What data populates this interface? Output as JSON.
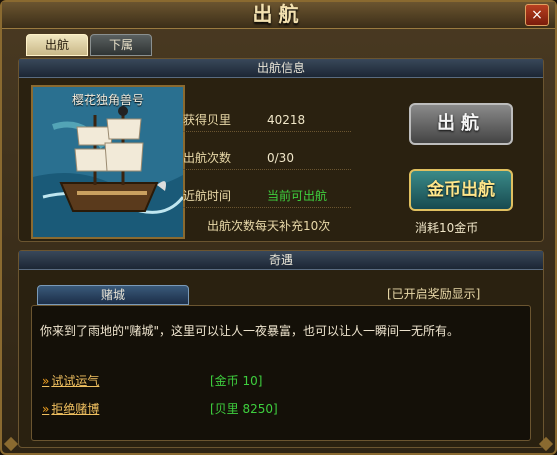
{
  "window": {
    "title": "出航",
    "close_label": "×"
  },
  "tabs": [
    {
      "label": "出航"
    },
    {
      "label": "下属"
    }
  ],
  "sail_info": {
    "header": "出航信息",
    "ship_name": "樱花独角兽号",
    "rows": [
      {
        "key": "获得贝里",
        "value": "40218"
      },
      {
        "key": "出航次数",
        "value": "0/30"
      },
      {
        "key": "近航时间",
        "value": "当前可出航"
      }
    ],
    "note": "出航次数每天补充10次",
    "sail_button": "出航",
    "gold_button": "金币出航",
    "gold_cost": "消耗10金币"
  },
  "encounter": {
    "header": "奇遇",
    "tab": "赌城",
    "reward_flag": "[已开启奖励显示]",
    "story": "你来到了雨地的\"赌城\"，这里可以让人一夜暴富，也可以让人一瞬间一无所有。",
    "options": [
      {
        "label": "试试运气",
        "result": "[金币  10]"
      },
      {
        "label": "拒绝赌博",
        "result": "[贝里  8250]"
      }
    ]
  },
  "colors": {
    "accent_green": "#3ecf3e",
    "gold": "#f0c060"
  }
}
